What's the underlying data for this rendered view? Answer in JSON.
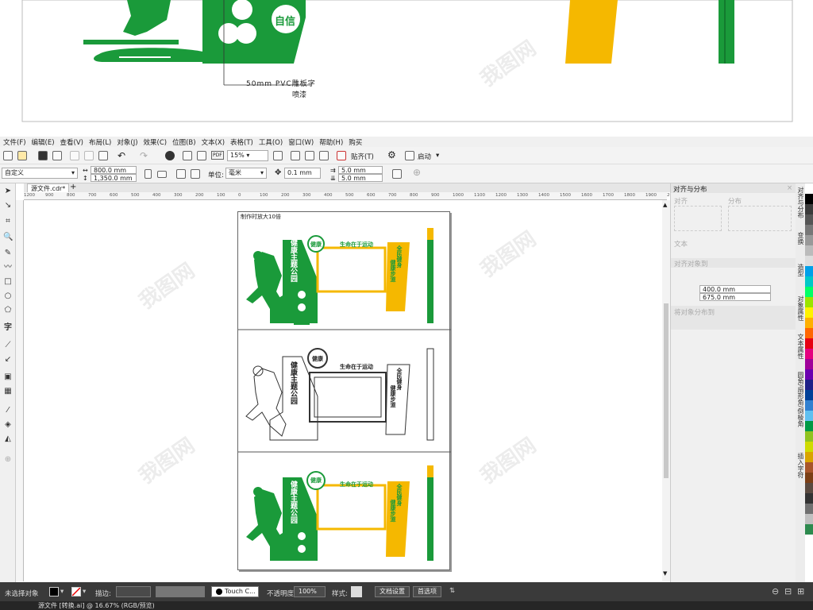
{
  "top_art": {
    "badge_text": "自信",
    "annotation_line1": "50mm PVC雕板字",
    "annotation_line2": "喷漆",
    "colors": {
      "green": "#1a9a3a",
      "yellow": "#f5b800"
    }
  },
  "menubar": {
    "items": [
      "文件(F)",
      "编辑(E)",
      "查看(V)",
      "布局(L)",
      "对象(J)",
      "效果(C)",
      "位图(B)",
      "文本(X)",
      "表格(T)",
      "工具(O)",
      "窗口(W)",
      "帮助(H)",
      "购买"
    ]
  },
  "toolbar1": {
    "zoom_value": "15%",
    "snap_label": "贴齐(T)",
    "launch_label": "启动"
  },
  "toolbar2": {
    "preset": "自定义",
    "width": "800.0 mm",
    "height": "1,350.0 mm",
    "units_label": "单位:",
    "units_value": "毫米",
    "nudge": "0.1 mm",
    "dup_x": "5.0 mm",
    "dup_y": "5.0 mm"
  },
  "document_tab": {
    "label": "源文件.cdr*",
    "add": "+"
  },
  "ruler": {
    "h_ticks": [
      "1200",
      "900",
      "800",
      "700",
      "600",
      "500",
      "400",
      "300",
      "200",
      "100",
      "0",
      "100",
      "200",
      "300",
      "400",
      "500",
      "600",
      "700",
      "800",
      "900",
      "1000",
      "1100",
      "1200",
      "1300",
      "1400",
      "1500",
      "1600",
      "1700",
      "1800",
      "1900",
      "2000"
    ],
    "v_ticks": [
      "1300",
      "1200",
      "1100",
      "1000",
      "900",
      "800",
      "700",
      "600",
      "500",
      "400",
      "300",
      "200",
      "100",
      "0"
    ]
  },
  "page": {
    "note": "制作时放大10倍",
    "panels": [
      {
        "style": "color",
        "badge": "健康",
        "title_vertical": "健康主题公园",
        "slogan": "生命在于运动",
        "right_text1": "全民健身",
        "right_text2": "健康步道"
      },
      {
        "style": "outline",
        "badge": "健康",
        "title_vertical": "健康主题公园",
        "slogan": "生命在于运动",
        "right_text1": "全民健身",
        "right_text2": "健康步道"
      },
      {
        "style": "color",
        "badge": "健康",
        "title_vertical": "健康主题公园",
        "slogan": "生命在于运动",
        "right_text1": "全民健身",
        "right_text2": "健康步道"
      }
    ]
  },
  "panel": {
    "title": "对齐与分布",
    "section_align": "对齐",
    "section_distribute": "分布",
    "section_text": "文本",
    "section_spacing": "对齐对象到",
    "section_spacing2": "将对象分布到",
    "spacing_h": "400.0 mm",
    "spacing_v": "675.0 mm"
  },
  "vtabs": [
    "对齐与分布",
    "变换",
    "造型",
    "对象属性",
    "文本属性",
    "圆角/扇形角/倒棱角",
    "插入字符"
  ],
  "palette_colors": [
    "#ffffff",
    "#000000",
    "#3b3b3b",
    "#555555",
    "#777777",
    "#999999",
    "#bbbbbb",
    "#dddddd",
    "#00a0e9",
    "#00c8c8",
    "#00ff66",
    "#9be400",
    "#fff200",
    "#ffb000",
    "#ff6600",
    "#e60012",
    "#e4007f",
    "#a0009a",
    "#6a00b0",
    "#1d2088",
    "#004098",
    "#3080d0",
    "#60c0f0",
    "#009944",
    "#8fc31f",
    "#cfdb00",
    "#d9a400",
    "#a8552a",
    "#7b3f16",
    "#5a4a40",
    "#333333",
    "#707070",
    "#c0c0c0",
    "#2d8a4e"
  ],
  "status": {
    "selection": "未选择对象",
    "outline_label": "描边:",
    "touch_label": "Touch C...",
    "opacity_label": "不透明度:",
    "opacity_value": "100%",
    "style_label": "样式:",
    "doc_settings": "文档设置",
    "first_page": "首选项"
  },
  "bottom": {
    "info": "源文件 [转换.ai] @ 16.67% (RGB/预览)"
  },
  "watermark": "我图网"
}
